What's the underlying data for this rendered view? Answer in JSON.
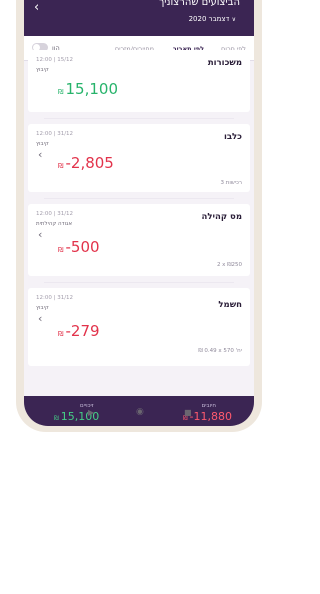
{
  "header": {
    "title": "הביצועים שהרצוניך",
    "month": "דצמבר 2020"
  },
  "tabs": [
    {
      "label": "לפי סכום"
    },
    {
      "label": "לפי תאריך"
    },
    {
      "label": "מחייבים/מזכים"
    }
  ],
  "toggle": {
    "label": "הוו"
  },
  "cards": [
    {
      "title": "משכורות",
      "time": "12:00 | 15/12",
      "tag": "קיבוץ",
      "amount": "15,100",
      "sign": "",
      "sub": "",
      "type": "pos"
    },
    {
      "title": "כלבו",
      "time": "12:00 | 31/12",
      "tag": "קיבוץ",
      "amount": "-2,805",
      "sign": "",
      "sub": "3 רכישות",
      "type": "neg"
    },
    {
      "title": "מס קהילה",
      "time": "12:00 | 31/12",
      "tag": "אגודה קהילתית",
      "amount": "-500",
      "sign": "",
      "sub": "2 x ₪250",
      "type": "neg"
    },
    {
      "title": "חשמל",
      "time": "12:00 | 31/12",
      "tag": "קיבוץ",
      "amount": "-279",
      "sign": "",
      "sub": "₪ 0.49 x יח' 570",
      "type": "neg"
    }
  ],
  "currency": "₪",
  "totals": {
    "debits_label": "חיובים",
    "debits_value": "-11,880",
    "credits_label": "זיכויים",
    "credits_value": "15,100"
  },
  "colors": {
    "header": "#3b2553",
    "positive": "#27b36b",
    "negative": "#e2334b"
  }
}
